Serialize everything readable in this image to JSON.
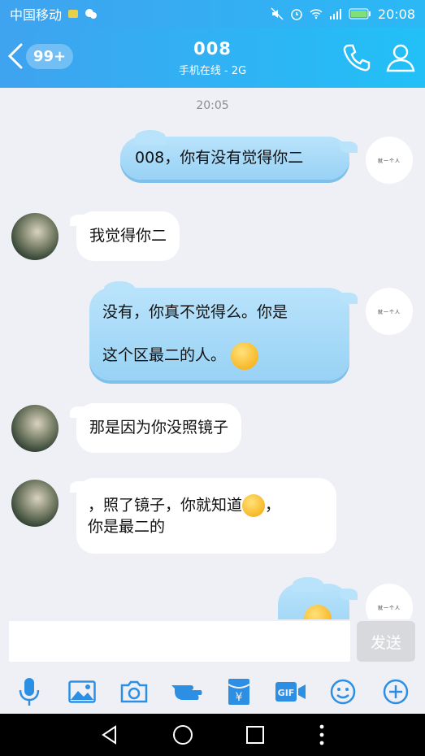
{
  "status_bar": {
    "carrier": "中国移动",
    "time": "20:08",
    "network": "2G"
  },
  "header": {
    "unread_badge": "99+",
    "title": "008",
    "subtitle": "手机在线 - 2G"
  },
  "chat": {
    "timestamp": "20:05",
    "self_avatar_text": "就一个人",
    "messages": [
      {
        "sender": "self",
        "text": "008，你有没有觉得你二"
      },
      {
        "sender": "other",
        "text": "我觉得你二"
      },
      {
        "sender": "self",
        "line1": "没有，你真不觉得么。你是",
        "line2": "这个区最二的人。"
      },
      {
        "sender": "other",
        "text": "那是因为你没照镜子"
      },
      {
        "sender": "other",
        "line1a": "，照了镜子，你就知道",
        "line1b": "，",
        "line2": "你是最二的"
      }
    ]
  },
  "composer": {
    "input_value": "",
    "send_label": "发送"
  },
  "toolbar": {
    "icons": [
      "microphone-icon",
      "image-icon",
      "camera-icon",
      "poke-hand-icon",
      "red-packet-icon",
      "gif-icon",
      "emoji-icon",
      "plus-icon"
    ],
    "accent": "#2d8fe3"
  }
}
